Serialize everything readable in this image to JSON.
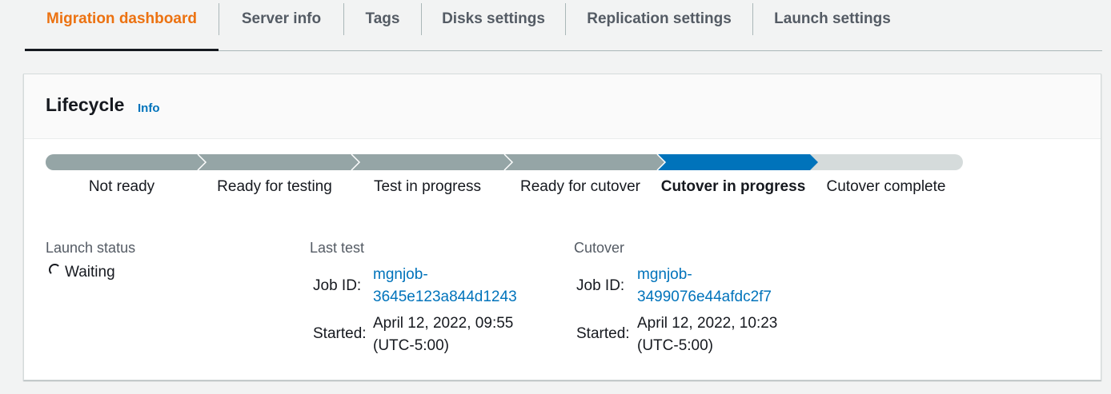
{
  "tabs": [
    {
      "label": "Migration dashboard",
      "active": true
    },
    {
      "label": "Server info",
      "active": false
    },
    {
      "label": "Tags",
      "active": false
    },
    {
      "label": "Disks settings",
      "active": false
    },
    {
      "label": "Replication settings",
      "active": false
    },
    {
      "label": "Launch settings",
      "active": false
    }
  ],
  "lifecycle": {
    "title": "Lifecycle",
    "info_label": "Info",
    "current_step_index": 4,
    "steps": [
      "Not ready",
      "Ready for testing",
      "Test in progress",
      "Ready for cutover",
      "Cutover in progress",
      "Cutover complete"
    ]
  },
  "launch_status": {
    "label": "Launch status",
    "value": "Waiting",
    "icon": "spinner-icon"
  },
  "last_test": {
    "label": "Last test",
    "job_id_label": "Job ID:",
    "job_id_line1": "mgnjob-",
    "job_id_line2": "3645e123a844d1243",
    "started_label": "Started:",
    "started_line1": "April 12, 2022, 09:55",
    "started_line2": "(UTC-5:00)"
  },
  "cutover": {
    "label": "Cutover",
    "job_id_label": "Job ID:",
    "job_id_line1": "mgnjob-",
    "job_id_line2": "3499076e44afdc2f7",
    "started_label": "Started:",
    "started_line1": "April 12, 2022, 10:23",
    "started_line2": "(UTC-5:00)"
  },
  "colors": {
    "accent": "#ec7211",
    "link": "#0073bb",
    "step_done": "#95a5a6",
    "step_current": "#0073bb",
    "step_pending": "#d5dbdb"
  }
}
